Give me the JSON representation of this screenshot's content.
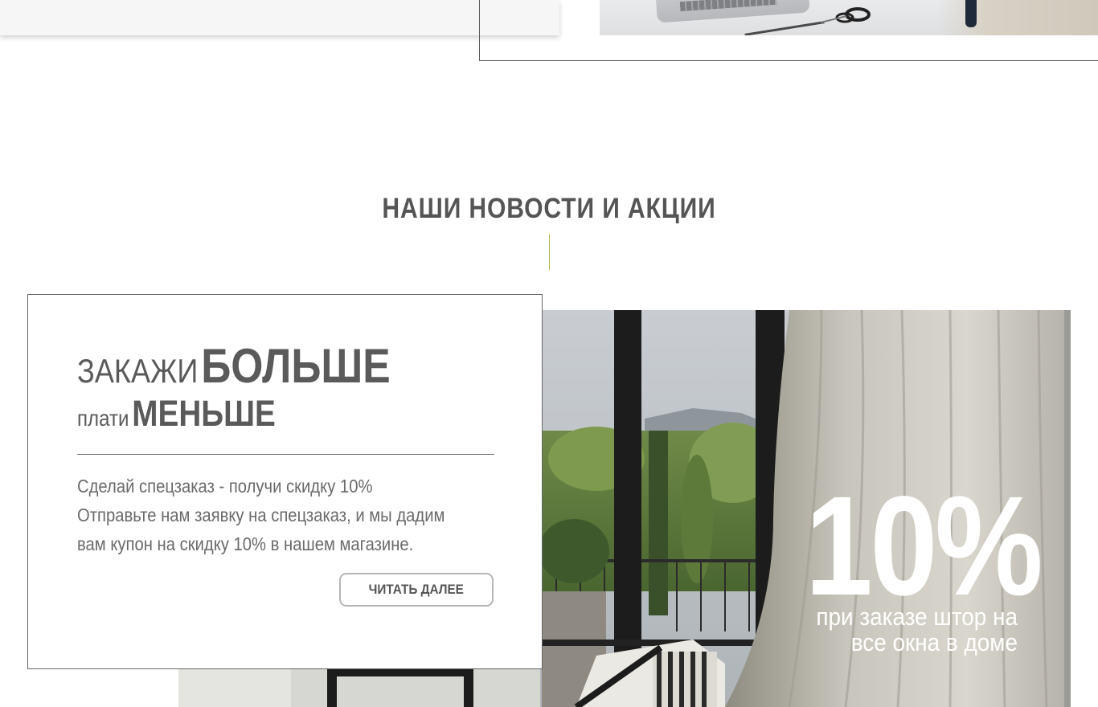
{
  "section": {
    "title": "НАШИ НОВОСТИ И АКЦИИ"
  },
  "promo": {
    "title_light_1": "ЗАКАЖИ",
    "title_bold_1": "БОЛЬШЕ",
    "title_light_2": "плати",
    "title_bold_2": "МЕНЬШЕ",
    "text_line_1": "Сделай спецзаказ - получи скидку 10%",
    "text_line_2": "Отправьте нам заявку на спецзаказ, и мы дадим",
    "text_line_3": "вам купон на скидку 10% в нашем магазине.",
    "button_label": "ЧИТАТЬ ДАЛЕЕ"
  },
  "banner": {
    "percent": "10%",
    "caption_line_1": "при заказе штор на",
    "caption_line_2": "все окна в доме"
  },
  "colors": {
    "accent_line": "#b8b04a",
    "text": "#555555",
    "border": "#666666"
  }
}
